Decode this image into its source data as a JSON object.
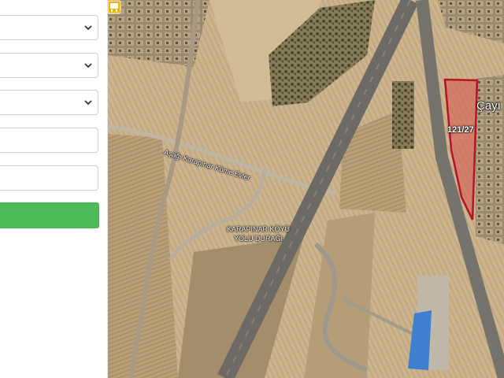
{
  "form": {
    "select_1": {
      "value": ""
    },
    "select_2": {
      "value": ""
    },
    "select_3": {
      "value": ""
    },
    "input_1": {
      "value": "",
      "placeholder": ""
    },
    "input_2": {
      "value": "",
      "placeholder": ""
    },
    "submit_label": ""
  },
  "map": {
    "road_label": "Aşağı Karapınar Küme Evler",
    "stop_label_line1": "KARAPINAR KÖYÜ",
    "stop_label_line2": "YOLU DURAĞI",
    "parcel_label": "121/27",
    "village_label": "Çayı",
    "parcel_outline_color": "#b3142a",
    "parcel_fill_color": "#d9534f",
    "stop_icon_color": "#f2b400",
    "stop_icon": "bus-stop-icon"
  },
  "colors": {
    "submit_green": "#4cba57",
    "field_border": "#cfcfcf"
  }
}
